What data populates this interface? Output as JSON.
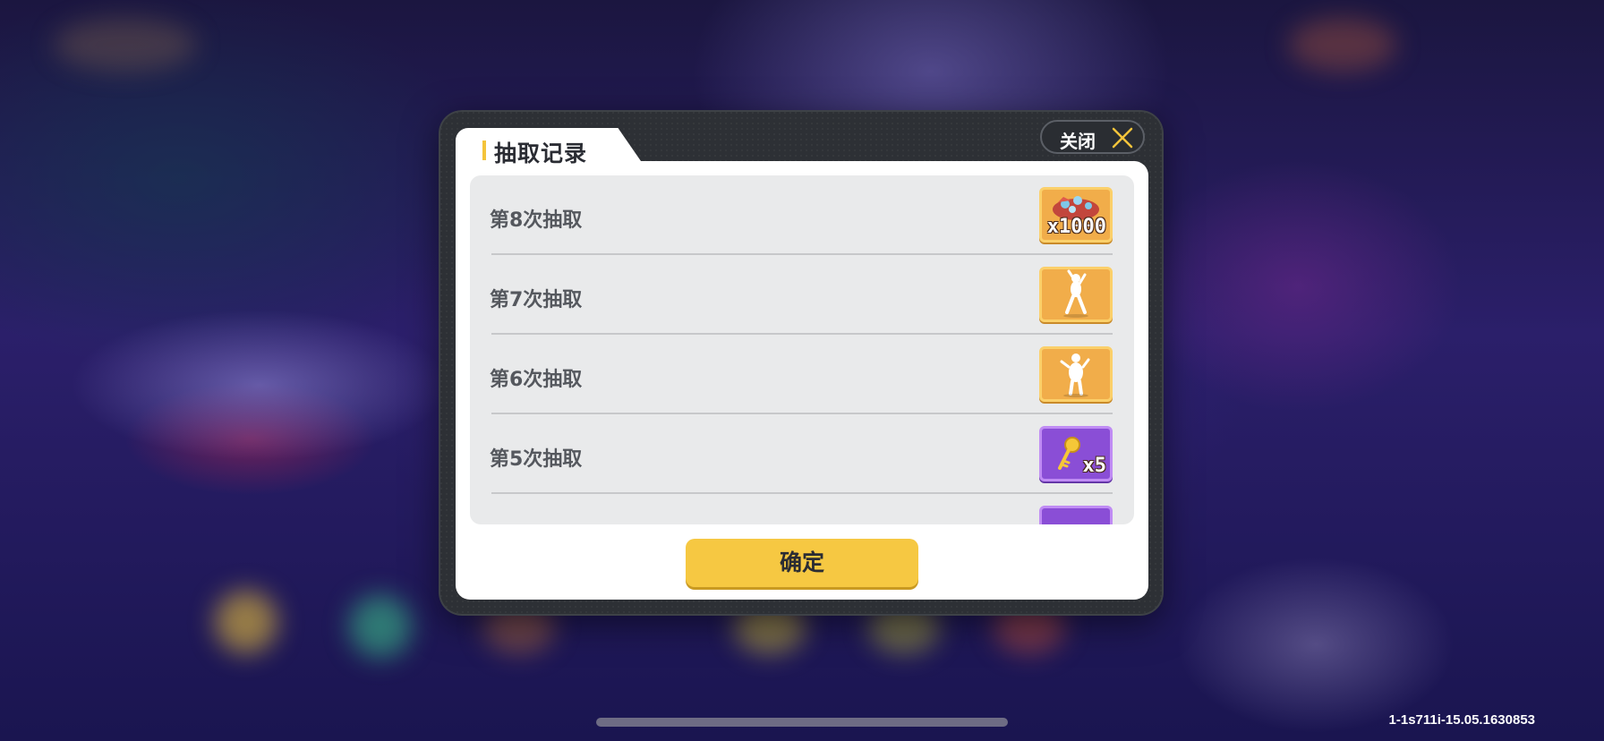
{
  "dialog": {
    "title": "抽取记录",
    "close_label": "关闭",
    "confirm_label": "确定",
    "records": [
      {
        "label": "第8次抽取",
        "reward_icon": "gem-pile-icon",
        "reward_color": "orange",
        "quantity": "x1000"
      },
      {
        "label": "第7次抽取",
        "reward_icon": "dance-pose-icon",
        "reward_color": "orange",
        "quantity": ""
      },
      {
        "label": "第6次抽取",
        "reward_icon": "dance-pose-icon",
        "reward_color": "orange",
        "quantity": ""
      },
      {
        "label": "第5次抽取",
        "reward_icon": "golden-key-icon",
        "reward_color": "purple",
        "quantity": "x5"
      }
    ]
  },
  "colors": {
    "accent_yellow": "#f6c842",
    "panel_dark": "#2d3035",
    "reward_orange": "#f1ad4a",
    "reward_purple": "#8a4ed6"
  },
  "footer": {
    "version": "1-1s711i-15.05.1630853"
  }
}
